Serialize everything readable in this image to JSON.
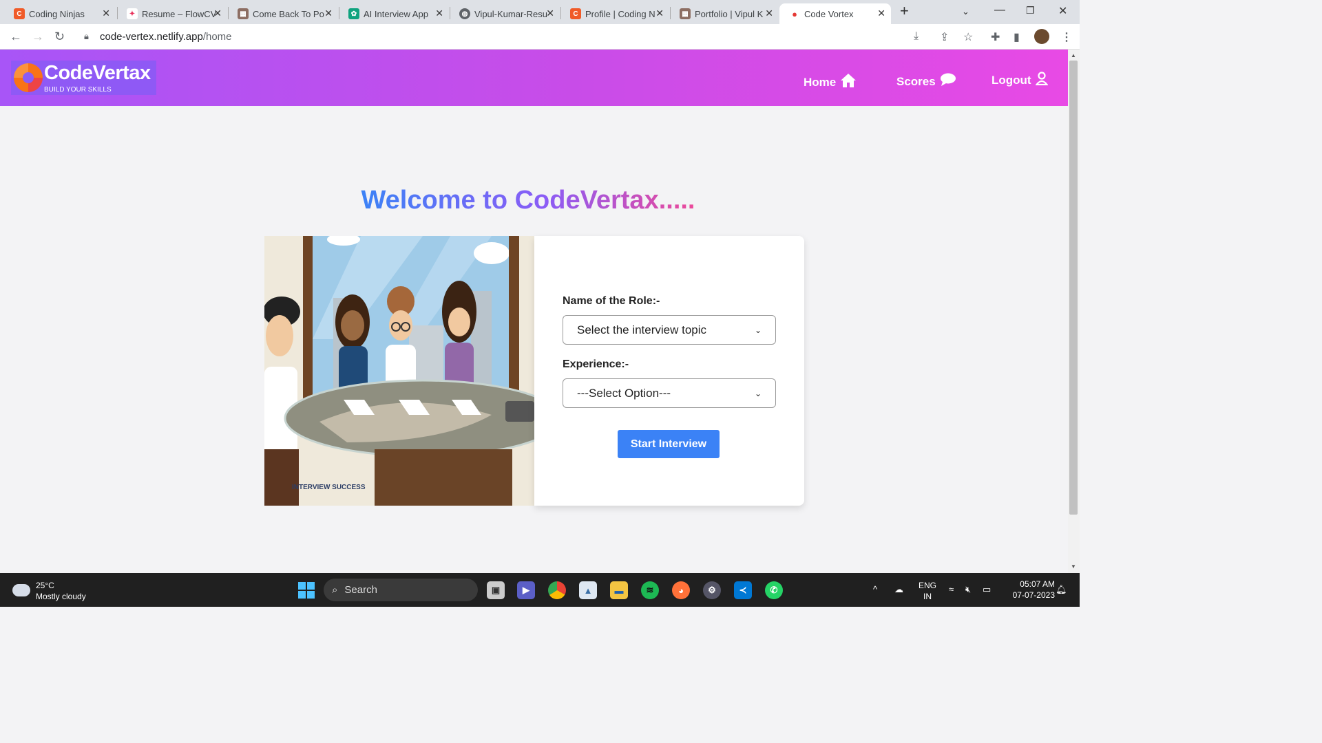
{
  "browser": {
    "tabs": [
      {
        "label": "Coding Ninjas",
        "icon": "coding-ninjas-icon",
        "color": "#f05a28"
      },
      {
        "label": "Resume – FlowCV",
        "icon": "flowcv-icon",
        "color": "#e8315b"
      },
      {
        "label": "Come Back To Po",
        "icon": "portfolio-icon",
        "color": "#8d6e63"
      },
      {
        "label": "AI Interview App",
        "icon": "chatgpt-icon",
        "color": "#10a37f"
      },
      {
        "label": "Vipul-Kumar-Resu",
        "icon": "globe-icon",
        "color": "#5f6368"
      },
      {
        "label": "Profile | Coding N",
        "icon": "coding-ninjas-icon",
        "color": "#f05a28"
      },
      {
        "label": "Portfolio | Vipul K",
        "icon": "portfolio-icon",
        "color": "#8d6e63"
      },
      {
        "label": "Code Vortex",
        "icon": "microphone-icon",
        "color": "#e53935",
        "active": true
      }
    ],
    "url_host": "code-vertex.netlify.app",
    "url_path": "/home"
  },
  "header": {
    "logo_name": "CodeVertax",
    "logo_tagline": "BUILD YOUR SKILLS",
    "nav": [
      {
        "label": "Home",
        "icon": "home-icon"
      },
      {
        "label": "Scores",
        "icon": "speech-bubble-icon"
      },
      {
        "label": "Logout",
        "icon": "user-icon"
      }
    ]
  },
  "main": {
    "title": "Welcome to CodeVertax.....",
    "role_label": "Name of the Role:-",
    "role_select": "Select the interview topic",
    "experience_label": "Experience:-",
    "experience_select": "---Select Option---",
    "start_button": "Start Interview",
    "illustration_watermark": "INTERVIEW SUCCESS"
  },
  "taskbar": {
    "weather_temp": "25°C",
    "weather_desc": "Mostly cloudy",
    "search_label": "Search",
    "lang_line1": "ENG",
    "lang_line2": "IN",
    "time": "05:07 AM",
    "date": "07-07-2023"
  },
  "colors": {
    "header_start": "#a855f7",
    "header_end": "#e84ae5",
    "button": "#3b82f6"
  }
}
